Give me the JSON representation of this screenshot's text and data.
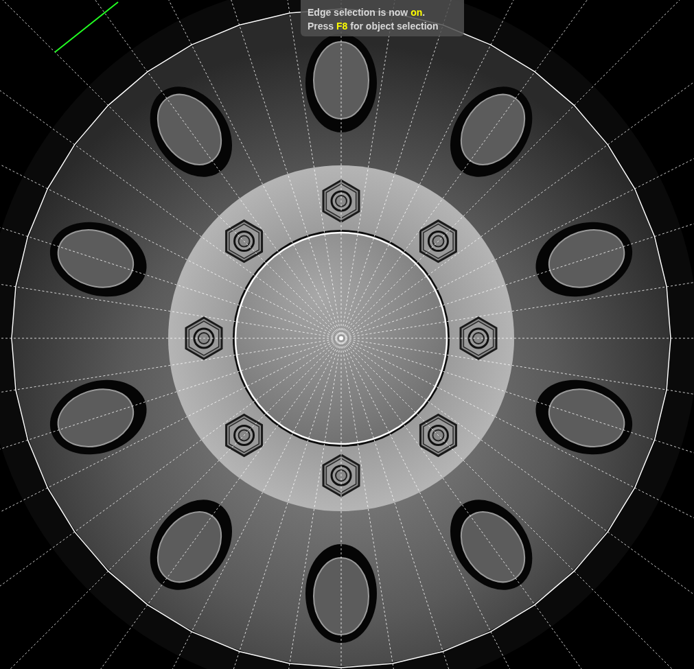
{
  "viewport": {
    "notice": {
      "lines": [
        [
          {
            "text": "Edge selection is now ",
            "kind": "plain"
          },
          {
            "text": "on",
            "kind": "highlight"
          },
          {
            "text": ".",
            "kind": "plain"
          }
        ],
        [
          {
            "text": "Press ",
            "kind": "plain"
          },
          {
            "text": "F8",
            "kind": "highlight"
          },
          {
            "text": " for object selection",
            "kind": "plain"
          }
        ]
      ]
    }
  }
}
